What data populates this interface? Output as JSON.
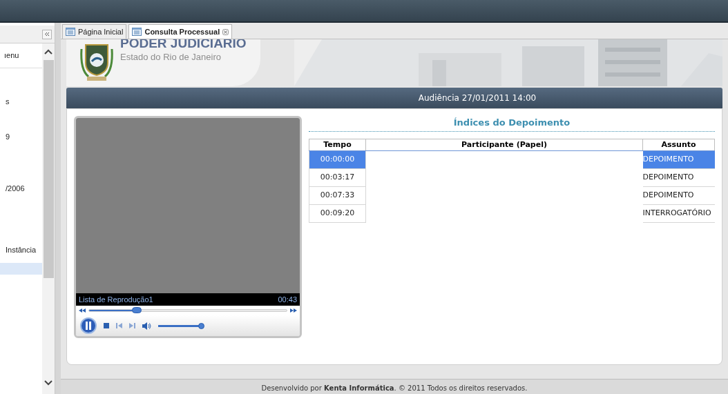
{
  "sidebar": {
    "header": "ıenu",
    "items": [
      {
        "label": "s",
        "selected": false
      },
      {
        "label": "9",
        "selected": false
      },
      {
        "label": "/2006",
        "selected": false
      },
      {
        "label": "Instância",
        "selected": false
      },
      {
        "selected": true
      }
    ]
  },
  "tabs": [
    {
      "label": "Página Inicial",
      "selected": false,
      "closable": false
    },
    {
      "label": "Consulta Processual",
      "selected": true,
      "closable": true
    }
  ],
  "banner": {
    "title": "PODER JUDICIARIO",
    "subtitle": "Estado do Rio de Janeiro"
  },
  "hearing_title": "Audiência 27/01/2011 14:00",
  "player": {
    "playlist": "Lista de Reprodução1",
    "time": "00:43",
    "playing": true,
    "seek": {
      "level": 0.24
    },
    "volume": {
      "level": 0.95
    }
  },
  "index": {
    "title": "Índices do Depoimento",
    "columns": [
      "Tempo",
      "Participante (Papel)",
      "Assunto"
    ],
    "rows": [
      {
        "tempo": "00:00:00",
        "assunto": "DEPOIMENTO",
        "selected": true
      },
      {
        "tempo": "00:03:17",
        "assunto": "DEPOIMENTO",
        "selected": false
      },
      {
        "tempo": "00:07:33",
        "assunto": "DEPOIMENTO",
        "selected": false
      },
      {
        "tempo": "00:09:20",
        "assunto": "INTERROGATÓRIO",
        "selected": false
      }
    ]
  },
  "footer": "Desenvolvido por **Kenta Informática**. © 2011 Todos os direitos reservados."
}
